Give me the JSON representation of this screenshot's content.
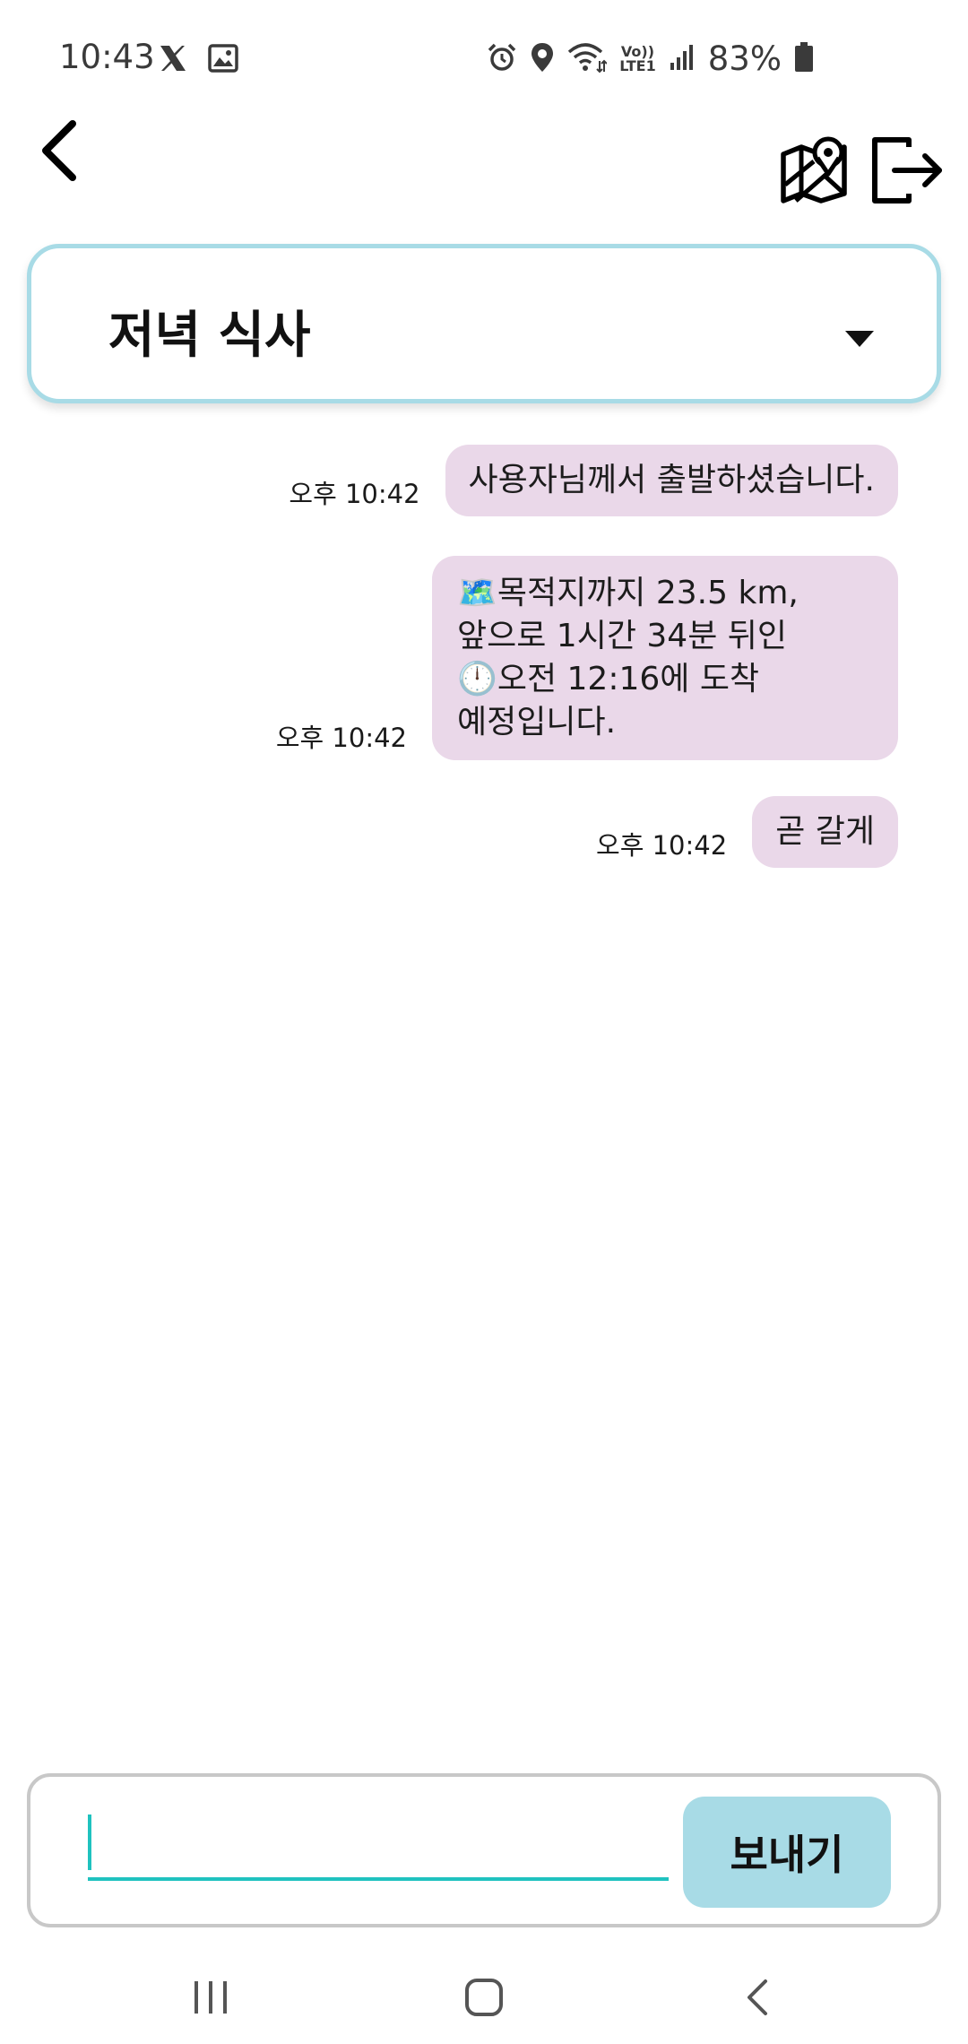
{
  "status_bar": {
    "time": "10:43",
    "battery_percent": "83%",
    "network_label_top": "Vo))",
    "network_label_bottom": "LTE1",
    "left_icons": [
      "x-logo-icon",
      "image-icon"
    ],
    "right_icons": [
      "alarm-icon",
      "location-pin-icon",
      "wifi-icon",
      "signal-icon",
      "battery-icon"
    ]
  },
  "header": {
    "icons": [
      "chevron-left-icon",
      "map-pin-icon",
      "logout-icon"
    ]
  },
  "room_selector": {
    "selected": "저녁 식사"
  },
  "messages": [
    {
      "time": "오후 10:42",
      "text": "사용자님께서 출발하셨습니다."
    },
    {
      "time": "오후 10:42",
      "text": "🗺️목적지까지 23.5 km,\n앞으로 1시간 34분 뒤인\n🕛오전 12:16에 도착\n예정입니다."
    },
    {
      "time": "오후 10:42",
      "text": "곧 갈게"
    }
  ],
  "composer": {
    "input_value": "",
    "send_label": "보내기"
  },
  "nav_bar": {
    "icons": [
      "recent-apps-icon",
      "home-icon",
      "back-icon"
    ]
  },
  "colors": {
    "accent_border": "#a8dbe6",
    "bubble": "#ead8e9",
    "input_underline": "#1fc2bf",
    "send_button": "#a8dbe6"
  }
}
